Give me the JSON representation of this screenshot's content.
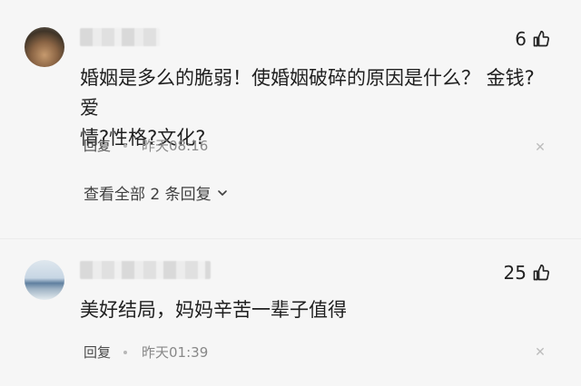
{
  "comments": [
    {
      "likes": "6",
      "text": "婚姻是多么的脆弱！使婚姻破碎的原因是什么？ 金钱?爱\n情?性格?文化?",
      "reply_label": "回复",
      "time": "昨天08:16",
      "view_replies_label": "查看全部 2 条回复"
    },
    {
      "likes": "25",
      "text": "美好结局，妈妈辛苦一辈子值得",
      "reply_label": "回复",
      "time": "昨天01:39"
    }
  ],
  "icons": {
    "like": "thumbs-up-icon",
    "close": "close-icon",
    "expand": "chevron-down-icon"
  },
  "colors": {
    "background": "#f6f6f6",
    "text": "#222222",
    "meta": "#888888"
  }
}
